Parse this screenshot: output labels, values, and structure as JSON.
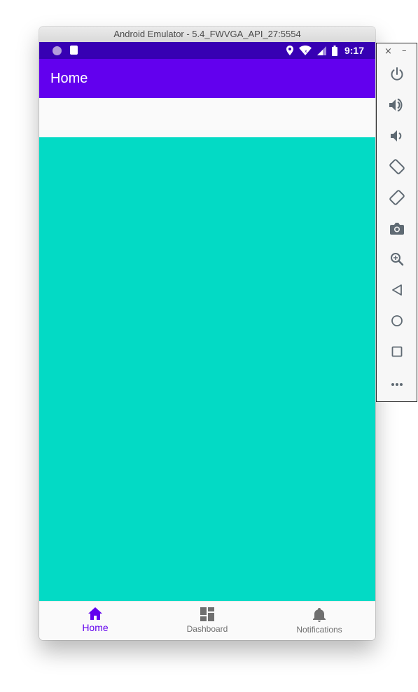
{
  "window": {
    "title": "Android Emulator - 5.4_FWVGA_API_27:5554"
  },
  "status_bar": {
    "time": "9:17",
    "icons": [
      "notification-dot-icon",
      "sd-card-icon",
      "location-icon",
      "wifi-icon",
      "signal-icon",
      "battery-icon"
    ],
    "background": "#3700b3"
  },
  "app_bar": {
    "title": "Home",
    "background": "#6200ee"
  },
  "content": {
    "panel_color": "#03dac5"
  },
  "bottom_nav": {
    "items": [
      {
        "label": "Home",
        "icon": "home-icon",
        "active": true
      },
      {
        "label": "Dashboard",
        "icon": "dashboard-icon",
        "active": false
      },
      {
        "label": "Notifications",
        "icon": "bell-icon",
        "active": false
      }
    ],
    "active_color": "#6200ee",
    "inactive_color": "#6f6f6f"
  },
  "emulator_toolbar": {
    "close_label": "×",
    "minimize_label": "–",
    "buttons": [
      "power-icon",
      "volume-up-icon",
      "volume-down-icon",
      "rotate-left-icon",
      "rotate-right-icon",
      "camera-icon",
      "zoom-icon",
      "back-icon",
      "home-circle-icon",
      "overview-icon",
      "more-icon"
    ]
  }
}
